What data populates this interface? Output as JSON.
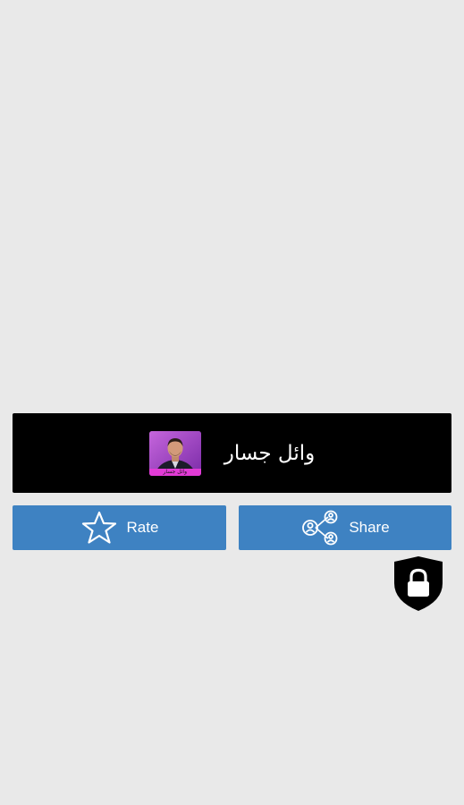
{
  "banner": {
    "title": "وائل جسار",
    "thumbnail_caption": "وائل جسار"
  },
  "buttons": {
    "rate_label": "Rate",
    "share_label": "Share"
  },
  "icons": {
    "rate": "star-icon",
    "share": "share-network-icon",
    "lock": "lock-shield-icon"
  },
  "colors": {
    "background": "#e9e9e9",
    "banner": "#000000",
    "button": "#3e82c2",
    "button_text": "#ffffff",
    "thumbnail_accent": "#e23bd6"
  }
}
